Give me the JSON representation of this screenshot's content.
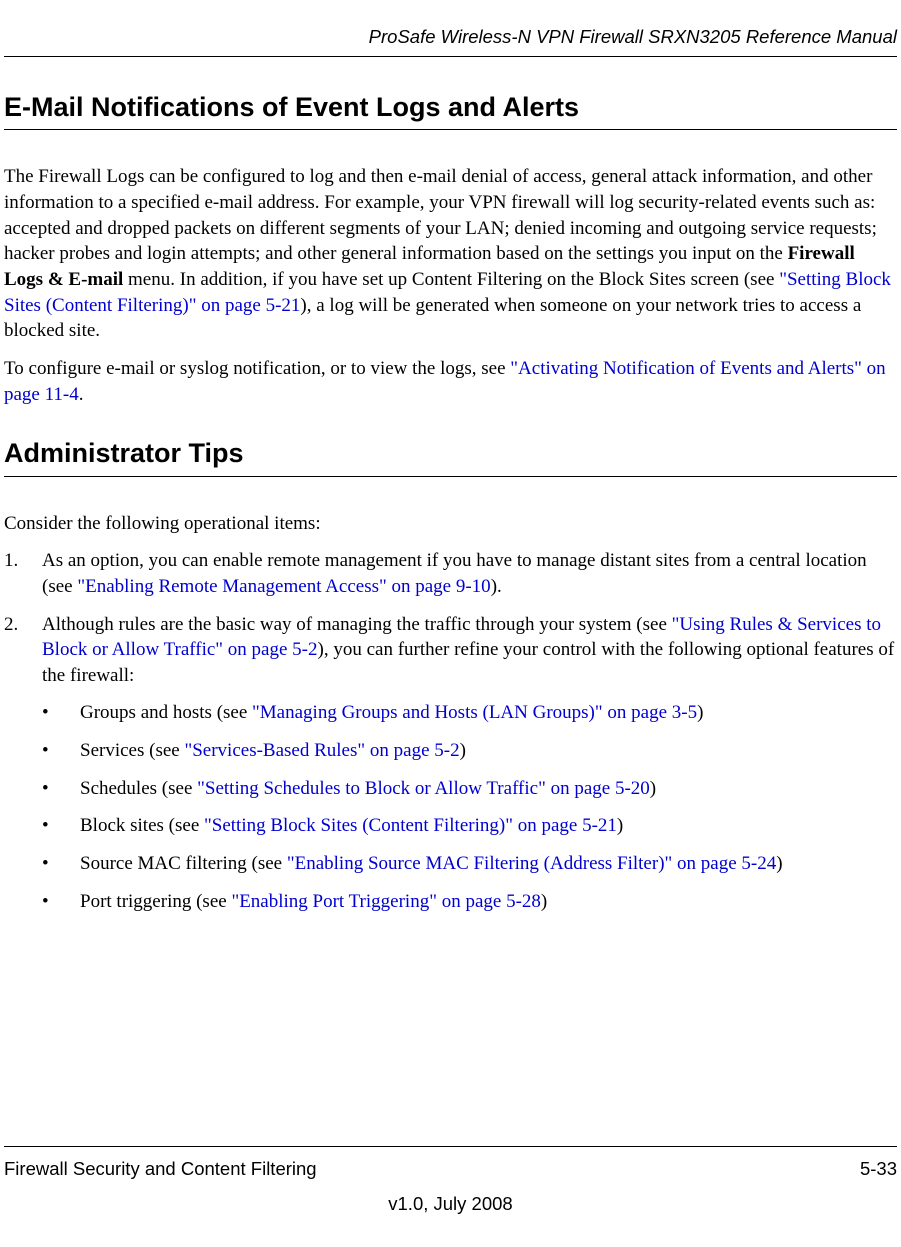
{
  "header": {
    "title": "ProSafe Wireless-N VPN Firewall SRXN3205 Reference Manual"
  },
  "section1": {
    "heading": "E-Mail Notifications of Event Logs and Alerts",
    "p1a": "The Firewall Logs can be configured to log and then e-mail denial of access, general attack information, and other information to a specified e-mail address. For example, your VPN firewall will log security-related events such as: accepted and dropped packets on different segments of your LAN; denied incoming and outgoing service requests; hacker probes and login attempts; and other general information based on the settings you input on the ",
    "p1bold": "Firewall Logs & E-mail",
    "p1b": " menu. In addition, if you have set up Content Filtering on the Block Sites screen (see ",
    "p1link": "\"Setting Block Sites (Content Filtering)\" on page 5-21",
    "p1c": "), a log will be generated when someone on your network tries to access a blocked site.",
    "p2a": "To configure e-mail or syslog notification, or to view the logs, see ",
    "p2link": "\"Activating Notification of Events and Alerts\" on page 11-4",
    "p2b": "."
  },
  "section2": {
    "heading": "Administrator Tips",
    "intro": "Consider the following operational items:",
    "item1": {
      "num": "1.",
      "a": "As an option, you can enable remote management if you have to manage distant sites from a central location (see ",
      "link": "\"Enabling Remote Management Access\" on page 9-10",
      "b": ")."
    },
    "item2": {
      "num": "2.",
      "a": "Although rules are the basic way of managing the traffic through your system (see ",
      "link": "\"Using Rules & Services to Block or Allow Traffic\" on page 5-2",
      "b": "), you can further refine your control with the following optional features of the firewall:"
    },
    "bullets": {
      "b1a": "Groups and hosts (see ",
      "b1link": "\"Managing Groups and Hosts (LAN Groups)\" on page 3-5",
      "b1b": ")",
      "b2a": "Services (see ",
      "b2link": "\"Services-Based Rules\" on page 5-2",
      "b2b": ")",
      "b3a": "Schedules (see ",
      "b3link": "\"Setting Schedules to Block or Allow Traffic\" on page 5-20",
      "b3b": ")",
      "b4a": "Block sites (see ",
      "b4link": "\"Setting Block Sites (Content Filtering)\" on page 5-21",
      "b4b": ")",
      "b5a": "Source MAC filtering (see ",
      "b5link": "\"Enabling Source MAC Filtering (Address Filter)\" on page 5-24",
      "b5b": ")",
      "b6a": "Port triggering (see ",
      "b6link": "\"Enabling Port Triggering\" on page 5-28",
      "b6b": ")"
    },
    "bulletchar": "•"
  },
  "footer": {
    "left": "Firewall Security and Content Filtering",
    "right": "5-33",
    "center": "v1.0, July 2008"
  }
}
